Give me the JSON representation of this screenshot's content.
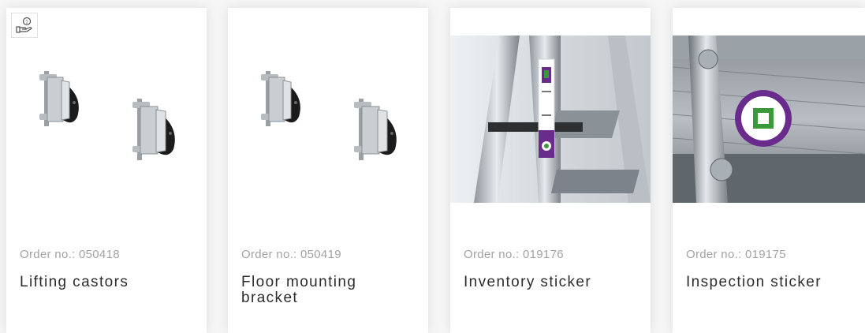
{
  "products": [
    {
      "order_label": "Order no.: 050418",
      "name": "Lifting castors",
      "badge_icon": "hand-coin-icon",
      "image": "lifting-castors-image"
    },
    {
      "order_label": "Order no.: 050419",
      "name": "Floor mounting bracket",
      "image": "floor-mounting-bracket-image"
    },
    {
      "order_label": "Order no.: 019176",
      "name": "Inventory sticker",
      "image": "inventory-sticker-photo"
    },
    {
      "order_label": "Order no.: 019175",
      "name": "Inspection sticker",
      "image": "inspection-sticker-photo"
    }
  ],
  "colors": {
    "card_bg": "#ffffff",
    "page_bg": "#f6f6f6",
    "order_text": "#a3a3a3",
    "name_text": "#2c2c2c",
    "sticker_purple": "#6a2c8c",
    "sticker_green": "#3a9a3a"
  }
}
